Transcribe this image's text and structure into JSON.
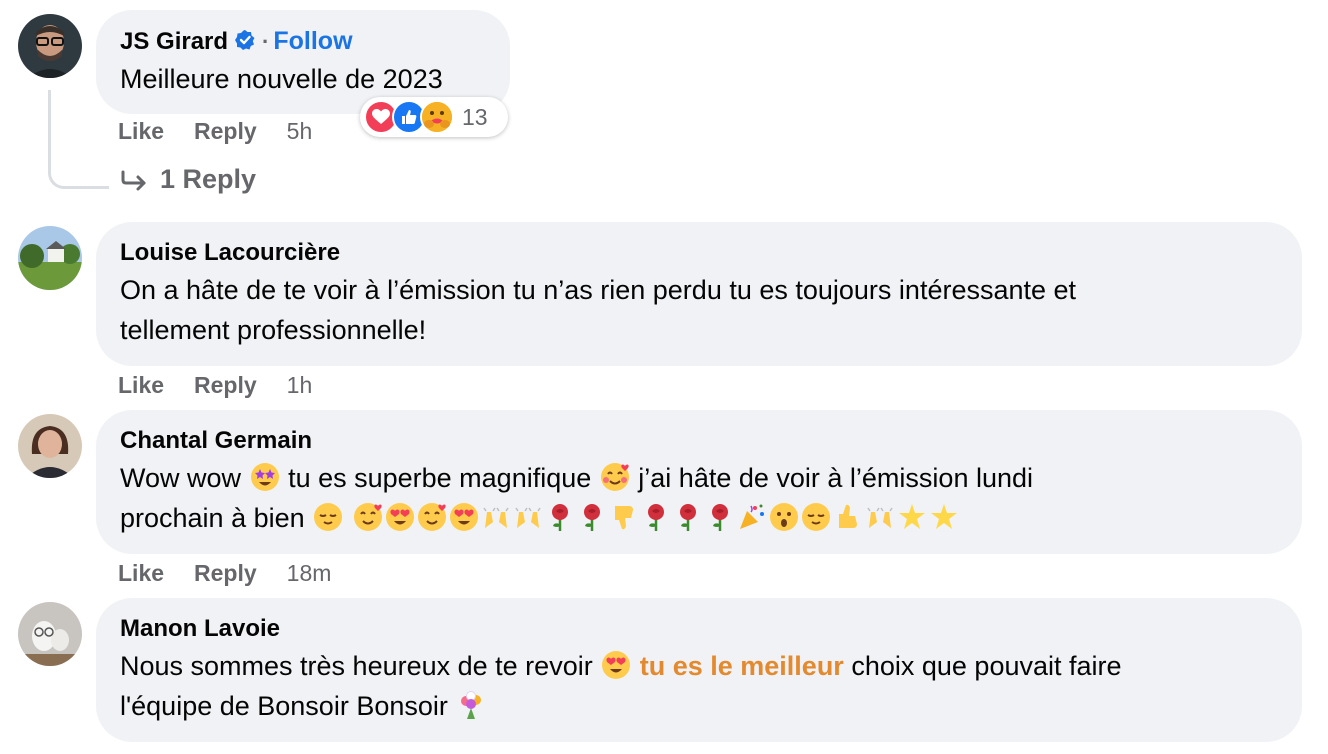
{
  "comments": [
    {
      "author": "JS Girard",
      "follow_label": "Follow",
      "text": "Meilleure nouvelle de 2023",
      "like_label": "Like",
      "reply_label": "Reply",
      "time": "5h",
      "reaction_count": "13",
      "reactions": [
        "love-icon",
        "like-icon",
        "care-icon"
      ],
      "replies_label": "1 Reply"
    },
    {
      "author": "Louise Lacourcière",
      "text_line1": "On a hâte de te voir à l’émission tu n’as rien perdu tu es toujours intéressante et",
      "text_line2": "tellement professionnelle!",
      "like_label": "Like",
      "reply_label": "Reply",
      "time": "1h"
    },
    {
      "author": "Chantal Germain",
      "text_part1": "Wow wow",
      "text_part2": "tu es superbe magnifique",
      "text_part3": "j’ai hâte de voir à l’émission lundi",
      "text_part4": "prochain à bien",
      "like_label": "Like",
      "reply_label": "Reply",
      "time": "18m"
    },
    {
      "author": "Manon Lavoie",
      "text_part1": "Nous sommes très heureux de te revoir",
      "highlight": "tu es le meilleur",
      "text_part2": "choix que pouvait faire",
      "text_part3": "l'équipe de Bonsoir Bonsoir"
    }
  ],
  "colors": {
    "bubble": "#f0f2f5",
    "link": "#1b74e4",
    "meta": "#65676b",
    "highlight": "#e38a2f"
  }
}
